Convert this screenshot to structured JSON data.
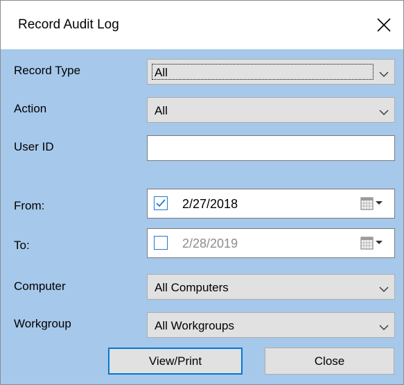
{
  "window": {
    "title": "Record Audit Log"
  },
  "fields": {
    "record_type": {
      "label": "Record Type",
      "value": "All"
    },
    "action": {
      "label": "Action",
      "value": "All"
    },
    "user_id": {
      "label": "User ID",
      "value": ""
    },
    "from": {
      "label": "From:",
      "value": "2/27/2018",
      "checked": true
    },
    "to": {
      "label": "To:",
      "value": "2/28/2019",
      "checked": false
    },
    "computer": {
      "label": "Computer",
      "value": "All Computers"
    },
    "workgroup": {
      "label": "Workgroup",
      "value": "All Workgroups"
    }
  },
  "buttons": {
    "view_print": "View/Print",
    "close": "Close"
  },
  "icons": [
    "close-icon",
    "chevron-down-icon",
    "calendar-icon",
    "checkmark-icon"
  ],
  "colors": {
    "background": "#a6c8ea",
    "accent": "#0078d7",
    "checkbox": "#1f78d1",
    "disabled_text": "#8c8c8c"
  }
}
